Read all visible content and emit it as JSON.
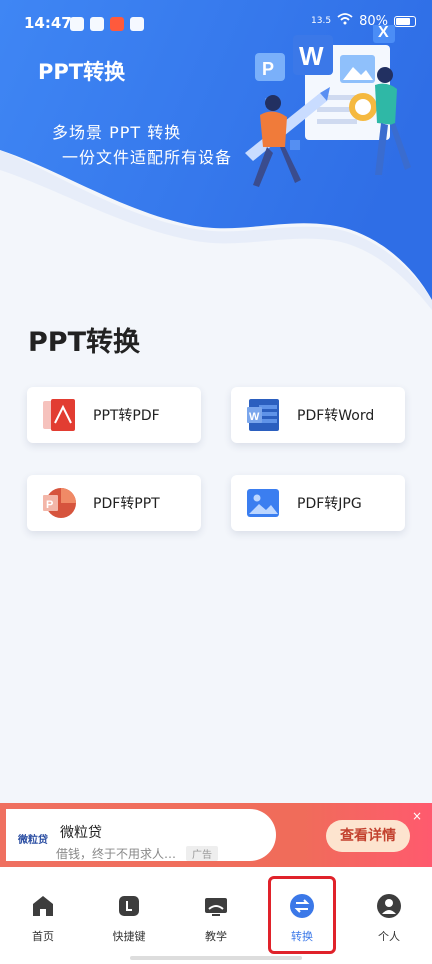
{
  "status_bar": {
    "time": "14:47",
    "network_speed": "13.5",
    "battery": "80%"
  },
  "hero": {
    "title": "PPT转换",
    "line1": "多场景 PPT 转换",
    "line2": "一份文件适配所有设备",
    "badge_p": "P",
    "badge_w": "W",
    "badge_x": "X"
  },
  "section": {
    "title": "PPT转换",
    "tools": [
      {
        "label": "PPT转PDF",
        "icon": "ppt-to-pdf-icon"
      },
      {
        "label": "PDF转Word",
        "icon": "word-icon"
      },
      {
        "label": "PDF转PPT",
        "icon": "ppt-icon"
      },
      {
        "label": "PDF转JPG",
        "icon": "image-icon"
      }
    ]
  },
  "ad": {
    "brand": "微粒贷",
    "title": "微粒贷",
    "subtitle": "借钱，终于不用求人…",
    "tag": "广告",
    "button": "查看详情",
    "close": "×"
  },
  "nav": {
    "items": [
      {
        "label": "首页",
        "icon": "home-icon"
      },
      {
        "label": "快捷键",
        "icon": "shortcut-icon"
      },
      {
        "label": "教学",
        "icon": "teach-icon"
      },
      {
        "label": "转换",
        "icon": "convert-icon"
      },
      {
        "label": "个人",
        "icon": "person-icon"
      }
    ],
    "active": "转换"
  },
  "colors": {
    "hero_blue": "#3a7cf0",
    "accent": "#3b78e8",
    "highlight": "#e0222a"
  }
}
